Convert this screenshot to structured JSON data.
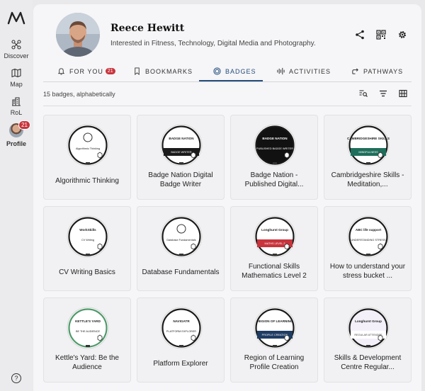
{
  "nav": {
    "items": [
      {
        "label": "Discover",
        "icon": "discover-icon"
      },
      {
        "label": "Map",
        "icon": "map-icon"
      },
      {
        "label": "RoL",
        "icon": "buildings-icon"
      },
      {
        "label": "Profile",
        "icon": "avatar",
        "count": "21"
      }
    ],
    "help_symbol": "?"
  },
  "profile": {
    "name": "Reece Hewitt",
    "bio": "Interested in Fitness, Technology, Digital Media and Photography."
  },
  "tabs": [
    {
      "label": "FOR YOU",
      "count": "21",
      "icon": "bell-icon"
    },
    {
      "label": "BOOKMARKS",
      "icon": "bookmark-icon"
    },
    {
      "label": "BADGES",
      "icon": "badge-icon",
      "active": true
    },
    {
      "label": "ACTIVITIES",
      "icon": "activities-icon"
    },
    {
      "label": "PATHWAYS",
      "icon": "pathways-icon"
    }
  ],
  "summary": "15 badges, alphabetically",
  "colors": {
    "accent": "#234c7c",
    "notification": "#c8343c"
  },
  "badges": [
    {
      "title": "Algorithmic Thinking",
      "inner_text": "Algorithmic Thinking",
      "style": "white"
    },
    {
      "title": "Badge Nation Digital Badge Writer",
      "inner_text": "BADGE WRITER",
      "logo_text": "BADGE NATION",
      "style": "dark-band"
    },
    {
      "title": "Badge Nation - Published Digital...",
      "inner_text": "PUBLISHED BADGE WRITER",
      "logo_text": "BADGE NATION",
      "style": "dark"
    },
    {
      "title": "Cambridgeshire Skills - Meditation,...",
      "inner_text": "MINDFULNESS",
      "logo_text": "CAMBRIDGESHIRE SKILLS",
      "style": "green"
    },
    {
      "title": "CV Writing Basics",
      "inner_text": "CV Writing",
      "logo_text": "WorkSkills",
      "style": "white"
    },
    {
      "title": "Database Fundamentals",
      "inner_text": "Database Fundamentals",
      "style": "white"
    },
    {
      "title": "Functional Skills Mathematics Level 2",
      "inner_text": "MATHS LEVEL 2",
      "logo_text": "Longhurst Group",
      "style": "red"
    },
    {
      "title": "How to understand your stress bucket ...",
      "inner_text": "UNDERSTANDING STRESS",
      "logo_text": "ABC life support",
      "style": "white"
    },
    {
      "title": "Kettle's Yard: Be the Audience",
      "inner_text": "BE THE AUDIENCE",
      "logo_text": "KETTLE'S YARD",
      "style": "white-green"
    },
    {
      "title": "Platform Explorer",
      "inner_text": "PLATFORM EXPLORER",
      "logo_text": "NAVIGATR",
      "style": "white"
    },
    {
      "title": "Region of Learning Profile Creation",
      "inner_text": "PROFILE CREATION",
      "logo_text": "REGION OF LEARNING",
      "style": "navy"
    },
    {
      "title": "Skills & Development Centre Regular...",
      "inner_text": "REGULAR ATTENDEE",
      "logo_text": "Longhurst Group",
      "style": "lavender"
    }
  ]
}
